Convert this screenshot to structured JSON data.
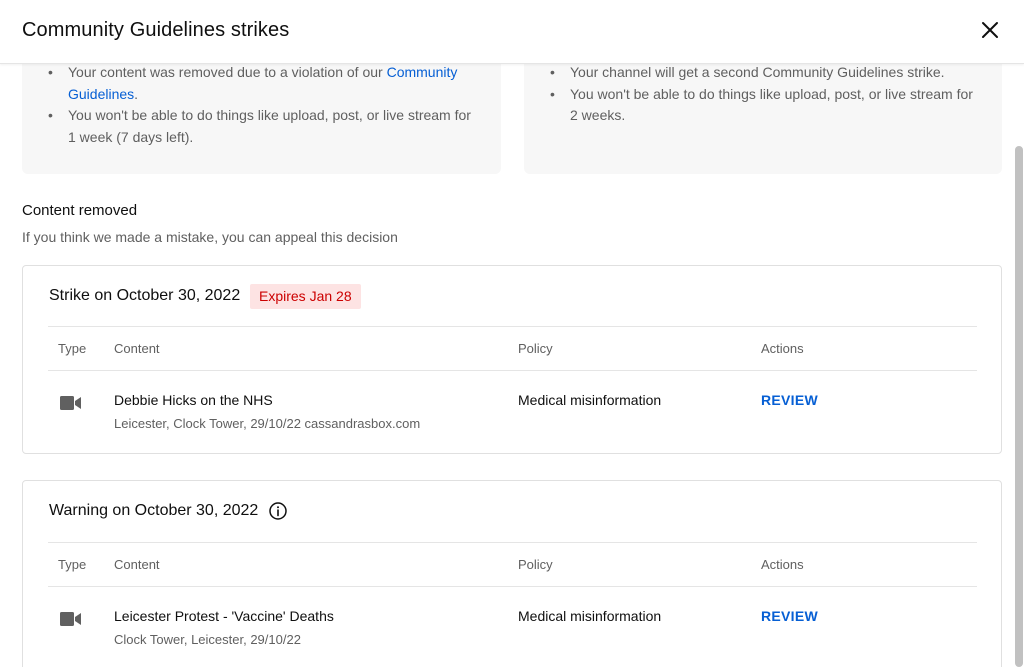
{
  "dialog": {
    "title": "Community Guidelines strikes"
  },
  "info": {
    "left": {
      "item1_prefix": "Your content was removed due to a violation of our ",
      "item1_link": "Community Guidelines",
      "item1_suffix": ".",
      "item2": "You won't be able to do things like upload, post, or live stream for 1 week (7 days left)."
    },
    "right": {
      "item1": "Your channel will get a second Community Guidelines strike.",
      "item2": "You won't be able to do things like upload, post, or live stream for 2 weeks."
    }
  },
  "section": {
    "title": "Content removed",
    "subtitle": "If you think we made a mistake, you can appeal this decision"
  },
  "columns": {
    "type": "Type",
    "content": "Content",
    "policy": "Policy",
    "actions": "Actions"
  },
  "cards": [
    {
      "title": "Strike on October 30, 2022",
      "badge": "Expires Jan 28",
      "row": {
        "icon": "video-camera-icon",
        "title": "Debbie Hicks on the NHS",
        "subtitle": "Leicester, Clock Tower, 29/10/22 cassandrasbox.com",
        "policy": "Medical misinformation",
        "action": "REVIEW"
      }
    },
    {
      "title": "Warning on October 30, 2022",
      "icon": "info-circle-icon",
      "row": {
        "icon": "video-camera-icon",
        "title": "Leicester Protest - 'Vaccine' Deaths",
        "subtitle": "Clock Tower, Leicester, 29/10/22",
        "policy": "Medical misinformation",
        "action": "REVIEW"
      }
    }
  ],
  "colors": {
    "link": "#065fd4",
    "badge_bg": "#fde3e3",
    "badge_text": "#cc0000",
    "panel_bg": "#f7f7f7"
  }
}
